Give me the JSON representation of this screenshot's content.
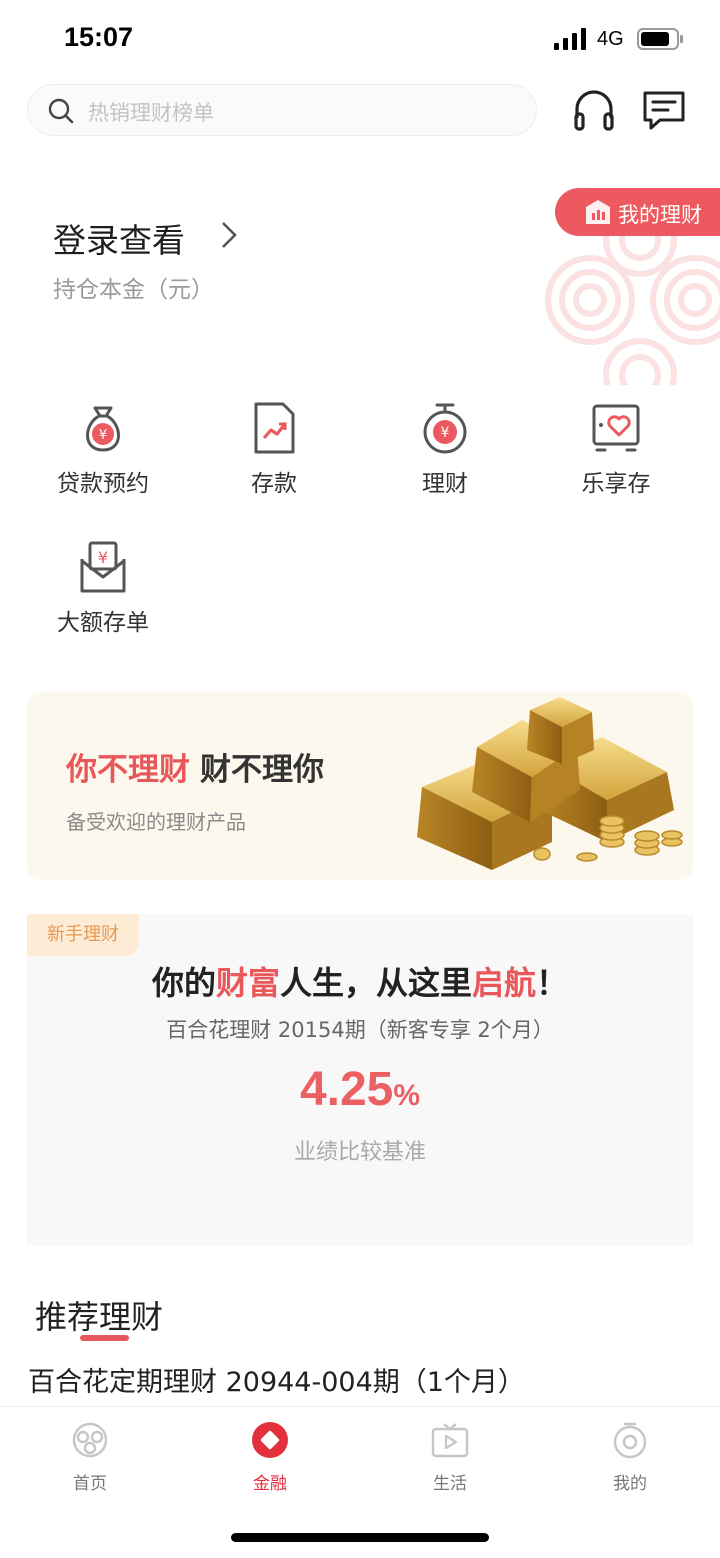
{
  "status_bar": {
    "time": "15:07",
    "network": "4G"
  },
  "header": {
    "search_placeholder": "热销理财榜单",
    "icons": [
      "search-icon",
      "headset-icon",
      "message-icon"
    ]
  },
  "account": {
    "login_label": "登录查看",
    "holding_label": "持仓本金（元）",
    "my_wealth_button": "我的理财"
  },
  "quick_actions": [
    {
      "label": "贷款预约",
      "icon": "money-bag-icon"
    },
    {
      "label": "存款",
      "icon": "document-chart-icon"
    },
    {
      "label": "理财",
      "icon": "timer-yuan-icon"
    },
    {
      "label": "乐享存",
      "icon": "heart-box-icon"
    },
    {
      "label": "大额存单",
      "icon": "envelope-yuan-icon"
    }
  ],
  "banner": {
    "title_red": "你不理财",
    "title_dark": "财不理你",
    "subtitle": "备受欢迎的理财产品"
  },
  "newbie": {
    "tag": "新手理财",
    "title_parts": [
      "你的",
      "财富",
      "人生，从这里",
      "启航",
      "！"
    ],
    "product": "百合花理财 20154期（新客专享 2个月）",
    "rate_value": "4.25",
    "rate_unit": "%",
    "rate_label": "业绩比较基准"
  },
  "recommended": {
    "title": "推荐理财",
    "items": [
      {
        "name": "百合花定期理财 20944-004期（1个月）"
      }
    ]
  },
  "tabbar": {
    "active": "金融",
    "tabs": [
      {
        "label": "首页",
        "icon": "home-logo-icon"
      },
      {
        "label": "金融",
        "icon": "finance-icon"
      },
      {
        "label": "生活",
        "icon": "tv-play-icon"
      },
      {
        "label": "我的",
        "icon": "profile-icon"
      }
    ]
  },
  "colors": {
    "accent": "#e8575a",
    "tab_active": "#e2303d",
    "banner_bg": "#fdf8ee",
    "tag_text": "#e69a55"
  }
}
